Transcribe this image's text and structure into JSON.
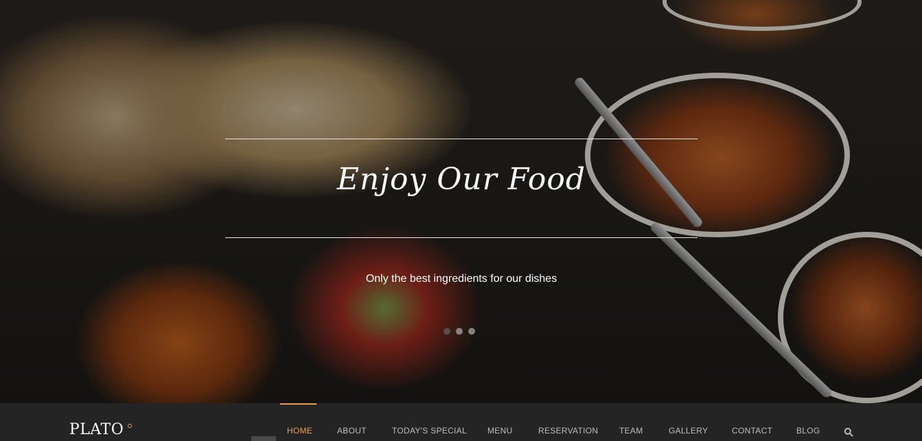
{
  "hero": {
    "title": "Enjoy Our Food",
    "subtitle": "Only the best ingredients for our dishes",
    "slides": 3,
    "active_slide": 1
  },
  "navbar": {
    "logo": "PLATO",
    "items": [
      {
        "label": "HOME",
        "active": true
      },
      {
        "label": "ABOUT"
      },
      {
        "label": "TODAY'S SPECIAL"
      },
      {
        "label": "MENU"
      },
      {
        "label": "RESERVATION"
      },
      {
        "label": "TEAM"
      },
      {
        "label": "GALLERY"
      },
      {
        "label": "CONTACT"
      },
      {
        "label": "BLOG"
      }
    ],
    "search_icon": "search-icon"
  },
  "colors": {
    "accent": "#e8a14a",
    "navbar_bg": "#242424",
    "nav_text": "#bdbdbd"
  }
}
